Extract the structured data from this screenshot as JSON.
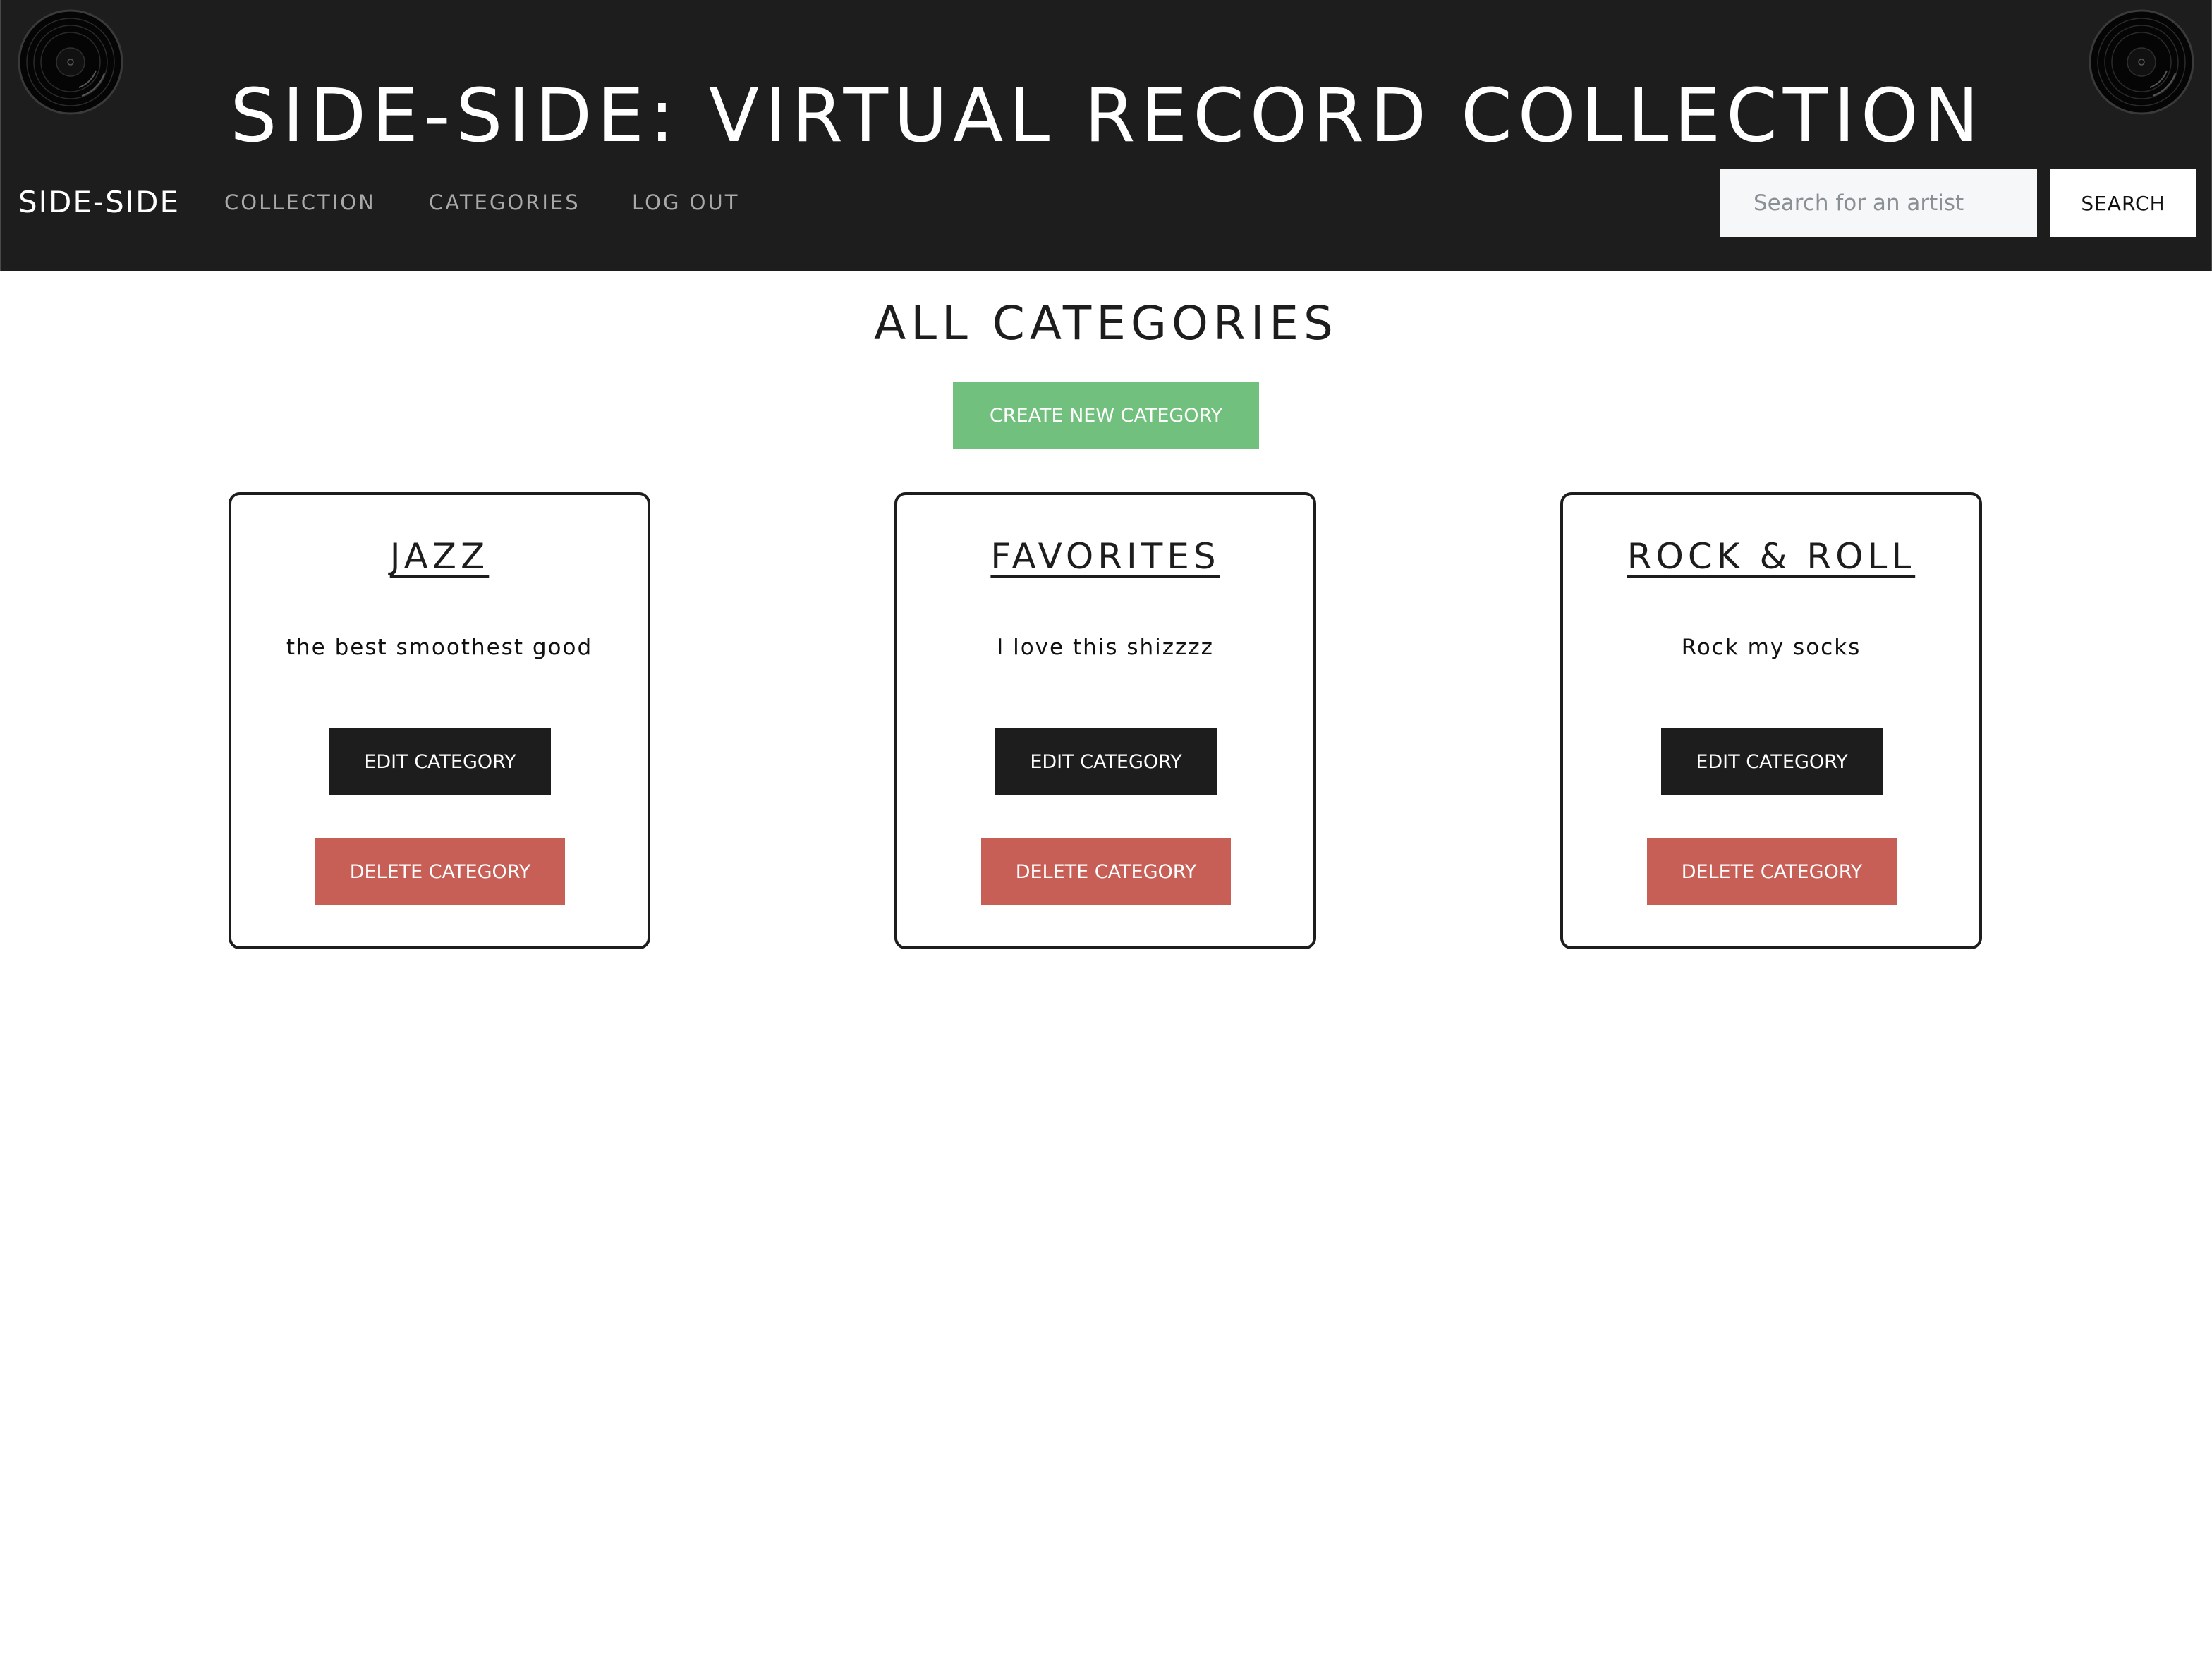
{
  "header": {
    "site_title": "SIDE-SIDE: VIRTUAL RECORD COLLECTION",
    "left_icon": "vinyl-record-icon",
    "right_icon": "vinyl-record-icon"
  },
  "navbar": {
    "brand": "SIDE-SIDE",
    "links": [
      "COLLECTION",
      "CATEGORIES",
      "LOG OUT"
    ],
    "search": {
      "placeholder": "Search for an artist",
      "value": "",
      "button_label": "SEARCH"
    }
  },
  "main": {
    "heading": "ALL CATEGORIES",
    "create_button_label": "CREATE NEW CATEGORY",
    "categories": [
      {
        "title": "JAZZ",
        "description": "the best smoothest good",
        "edit_label": "EDIT CATEGORY",
        "delete_label": "DELETE CATEGORY"
      },
      {
        "title": "FAVORITES",
        "description": "I love this shizzzz",
        "edit_label": "EDIT CATEGORY",
        "delete_label": "DELETE CATEGORY"
      },
      {
        "title": "ROCK & ROLL",
        "description": "Rock my socks",
        "edit_label": "EDIT CATEGORY",
        "delete_label": "DELETE CATEGORY"
      }
    ]
  },
  "colors": {
    "header_bg": "#1d1d1d",
    "create_button": "#71c07d",
    "edit_button": "#1d1d1d",
    "delete_button": "#c85f56",
    "nav_link": "#a9a9a9"
  }
}
